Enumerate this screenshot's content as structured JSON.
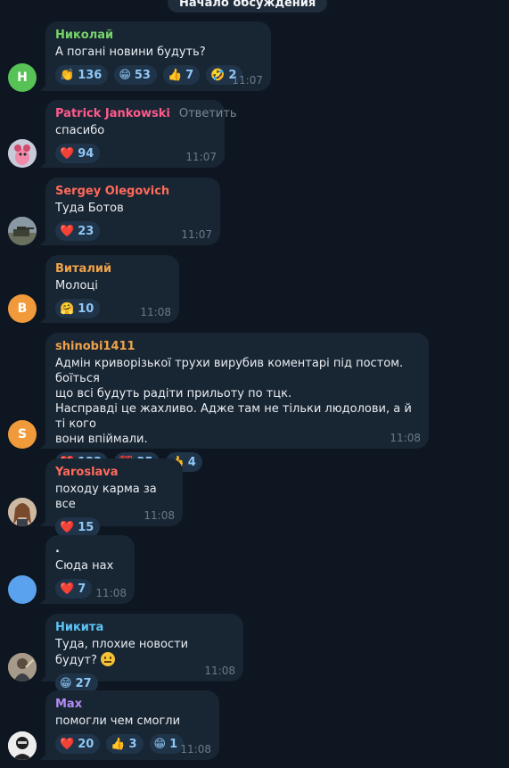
{
  "header": {
    "pill": "Начало обсуждения"
  },
  "messages": [
    {
      "author": "Николай",
      "text": "А погані новини будуть?",
      "time": "11:07",
      "avatar_letter": "Н",
      "avatar_color": "#57c255",
      "name_color": "#77d36a",
      "reactions": [
        {
          "emoji": "👏",
          "count": "136"
        },
        {
          "emoji": "😁",
          "count": "53"
        },
        {
          "emoji": "👍",
          "count": "7"
        },
        {
          "emoji": "🤣",
          "count": "2"
        }
      ]
    },
    {
      "author": "Patrick Jankowski",
      "reply": "Ответить",
      "text": "спасибо",
      "time": "11:07",
      "name_color": "#ff5a8c",
      "reactions": [
        {
          "emoji": "❤️",
          "count": "94"
        }
      ]
    },
    {
      "author": "Sergey Olegovich",
      "text": "Туда Ботов",
      "time": "11:07",
      "name_color": "#ff6a5a",
      "reactions": [
        {
          "emoji": "❤️",
          "count": "23"
        }
      ]
    },
    {
      "author": "Виталий",
      "text": "Молоці",
      "time": "11:08",
      "avatar_letter": "В",
      "avatar_color": "#f09a3c",
      "name_color": "#f0a24a",
      "reactions": [
        {
          "emoji": "🤗",
          "count": "10"
        }
      ]
    },
    {
      "author": "shinobi1411",
      "text": [
        "Адмін криворізької трухи вирубив коментарі під постом. боїться",
        "що всі будуть радіти прильоту по тцк.",
        "Насправді це жахливо. Адже там не тільки людолови, а й ті кого",
        "вони впіймали."
      ],
      "time": "11:08",
      "avatar_letter": "S",
      "avatar_color": "#f09a3c",
      "name_color": "#f0a24a",
      "reactions": [
        {
          "emoji": "❤️",
          "count": "122"
        },
        {
          "emoji": "💯",
          "count": "35"
        },
        {
          "emoji": "👍",
          "count": "4"
        }
      ]
    },
    {
      "author": "Yaroslava",
      "text": "походу карма за все",
      "time": "11:08",
      "name_color": "#ff6a5a",
      "reactions": [
        {
          "emoji": "❤️",
          "count": "15"
        }
      ]
    },
    {
      "author": ".",
      "text": "Сюда нах",
      "time": "11:08",
      "avatar_color": "#5aa2ee",
      "name_color": "#e9edf1",
      "reactions": [
        {
          "emoji": "❤️",
          "count": "7"
        }
      ]
    },
    {
      "author": "Никита",
      "text": "Туда, плохие новости будут?",
      "time": "11:08",
      "name_color": "#5bc4f5",
      "reactions": [
        {
          "emoji": "😁",
          "count": "27"
        }
      ]
    },
    {
      "author": "Max",
      "text": "помогли чем смогли",
      "time": "11:08",
      "name_color": "#b48cf4",
      "reactions": [
        {
          "emoji": "❤️",
          "count": "20"
        },
        {
          "emoji": "👍",
          "count": "3"
        },
        {
          "emoji": "😁",
          "count": "1"
        }
      ]
    }
  ]
}
